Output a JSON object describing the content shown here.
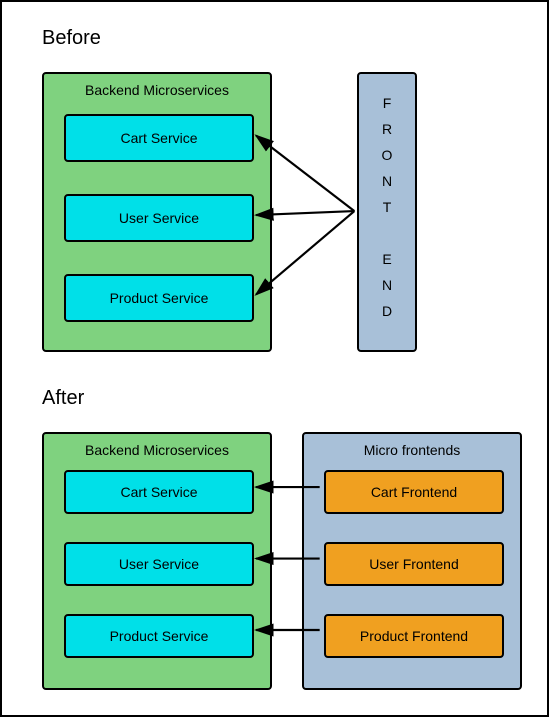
{
  "before": {
    "title": "Before",
    "backend": {
      "title": "Backend Microservices",
      "services": [
        "Cart Service",
        "User Service",
        "Product Service"
      ]
    },
    "frontend": {
      "label": "FRONT END"
    }
  },
  "after": {
    "title": "After",
    "backend": {
      "title": "Backend Microservices",
      "services": [
        "Cart Service",
        "User Service",
        "Product Service"
      ]
    },
    "frontends": {
      "title": "Micro frontends",
      "items": [
        "Cart Frontend",
        "User Frontend",
        "Product Frontend"
      ]
    }
  },
  "colors": {
    "backendPanel": "#7fd27f",
    "frontendPanel": "#a8c0d8",
    "service": "#00e0e8",
    "frontendItem": "#f0a020",
    "stroke": "#000000"
  }
}
